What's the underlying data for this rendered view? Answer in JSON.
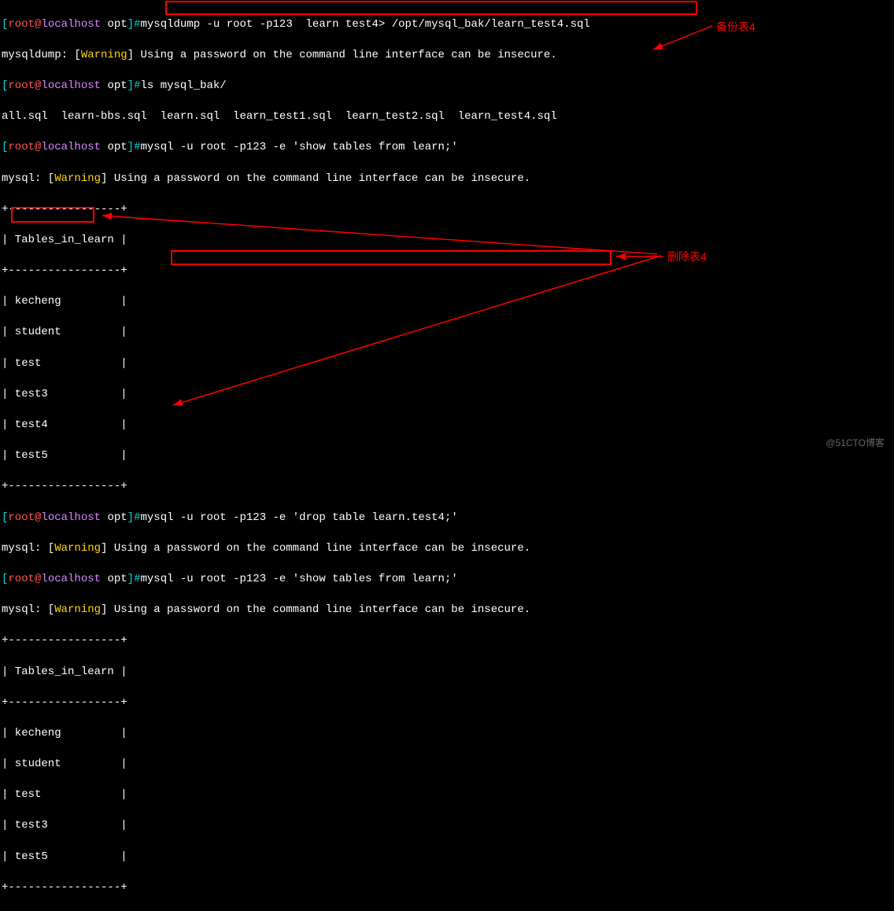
{
  "prompt": {
    "bracket_open": "[",
    "user": "root",
    "at": "@",
    "host": "localhost",
    "path": "opt",
    "bracket_close": "]",
    "hash": "#"
  },
  "lines": {
    "cmd1": "mysqldump -u root -p123  learn test4> /opt/mysql_bak/learn_test4.sql",
    "warn1a": "mysqldump: [",
    "warn1b": "Warning",
    "warn1c": "] Using a password on the command line interface can be insecure.",
    "cmd2": "ls mysql_bak/",
    "ls_output": "all.sql  learn-bbs.sql  learn.sql  learn_test1.sql  learn_test2.sql  learn_test4.sql",
    "cmd3": "mysql -u root -p123 -e 'show tables from learn;'",
    "warn2a": "mysql: [",
    "warn2b": "Warning",
    "warn2c": "] Using a password on the command line interface can be insecure.",
    "sep": "+-----------------+",
    "header": "| Tables_in_learn |",
    "t_kecheng": "| kecheng         |",
    "t_student": "| student         |",
    "t_test": "| test            |",
    "t_test3": "| test3           |",
    "t_test4": "| test4           |",
    "t_test5": "| test5           |",
    "cmd4": "mysql -u root -p123 -e 'drop table learn.test4;'",
    "cmd5": "mysql -u root -p123 -e 'show tables from learn;'"
  },
  "annotations": {
    "backup": "备份表4",
    "delete": "删除表4"
  },
  "watermark": "@51CTO博客"
}
